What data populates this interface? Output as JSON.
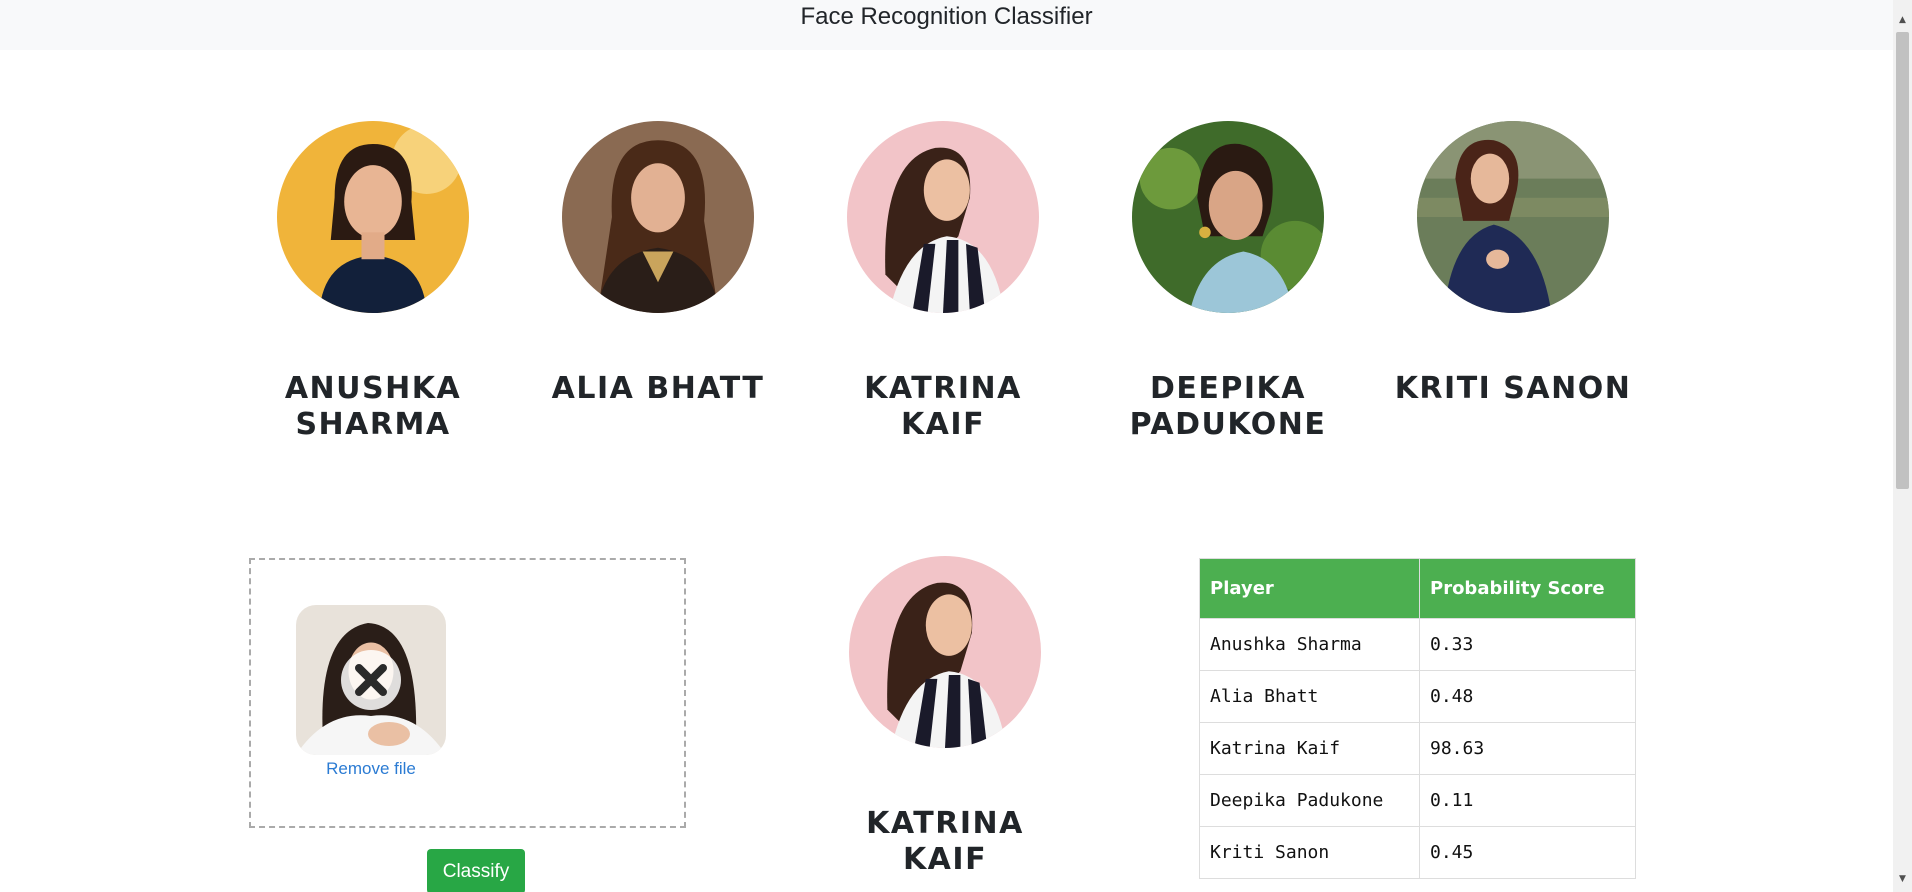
{
  "header": {
    "title": "Face Recognition Classifier"
  },
  "celebrities": [
    {
      "name": "ANUSHKA SHARMA"
    },
    {
      "name": "ALIA BHATT"
    },
    {
      "name": "KATRINA KAIF"
    },
    {
      "name": "DEEPIKA PADUKONE"
    },
    {
      "name": "KRITI SANON"
    }
  ],
  "upload": {
    "remove_label": "Remove file"
  },
  "classify_button": "Classify",
  "result": {
    "name": "KATRINA KAIF"
  },
  "table": {
    "headers": [
      "Player",
      "Probability Score"
    ],
    "rows": [
      [
        "Anushka Sharma",
        "0.33"
      ],
      [
        "Alia Bhatt",
        "0.48"
      ],
      [
        "Katrina Kaif",
        "98.63"
      ],
      [
        "Deepika Padukone",
        "0.11"
      ],
      [
        "Kriti Sanon",
        "0.45"
      ]
    ]
  },
  "colors": {
    "table_header": "#4caf50",
    "button": "#28a745",
    "link": "#2b7bd3"
  }
}
